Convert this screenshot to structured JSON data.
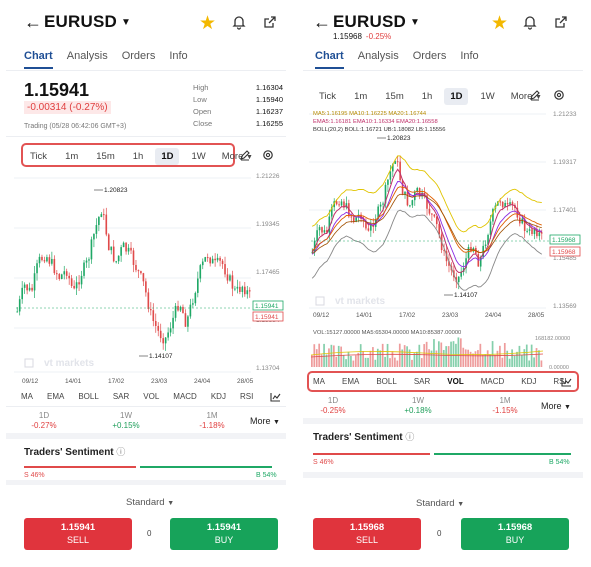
{
  "left": {
    "title": "EURUSD",
    "tabs": [
      "Chart",
      "Analysis",
      "Orders",
      "Info"
    ],
    "price": "1.15941",
    "change": "-0.00314 (-0.27%)",
    "trading_time": "Trading (05/28 06:42:06 GMT+3)",
    "stats": [
      {
        "label": "High",
        "value": "1.16304"
      },
      {
        "label": "Low",
        "value": "1.15940"
      },
      {
        "label": "Open",
        "value": "1.16237"
      },
      {
        "label": "Close",
        "value": "1.16255"
      }
    ],
    "timeframes": [
      "Tick",
      "1m",
      "15m",
      "1h",
      "1D",
      "1W",
      "More"
    ],
    "active_timeframe": "1D",
    "y_ticks": [
      "1.21226",
      "1.19345",
      "1.17465",
      "1.15584",
      "1.13704"
    ],
    "x_ticks": [
      "09/12",
      "14/01",
      "17/02",
      "23/03",
      "24/04",
      "28/05"
    ],
    "annotations": {
      "high": "1.20823",
      "low": "1.14107"
    },
    "price_tags": {
      "bid": "1.15941",
      "ask": "1.15941"
    },
    "watermark": "vt markets",
    "indicators": [
      "MA",
      "EMA",
      "BOLL",
      "SAR",
      "VOL",
      "MACD",
      "KDJ",
      "RSI"
    ],
    "changes": [
      {
        "label": "1D",
        "value": "-0.27%",
        "dir": "neg"
      },
      {
        "label": "1W",
        "value": "+0.15%",
        "dir": "pos"
      },
      {
        "label": "1M",
        "value": "-1.18%",
        "dir": "neg"
      }
    ],
    "more_label": "More",
    "sentiment_title": "Traders' Sentiment",
    "sentiment_sell": "S 46%",
    "sentiment_buy": "B 54%",
    "sell_fraction": 0.46,
    "order_type": "Standard",
    "sell_price": "1.15941",
    "sell_label": "SELL",
    "buy_price": "1.15941",
    "buy_label": "BUY",
    "spread": "0"
  },
  "right": {
    "title": "EURUSD",
    "subprice": "1.15968",
    "subchange": "-0.25%",
    "tabs": [
      "Chart",
      "Analysis",
      "Orders",
      "Info"
    ],
    "timeframes": [
      "Tick",
      "1m",
      "15m",
      "1h",
      "1D",
      "1W",
      "More"
    ],
    "active_timeframe": "1D",
    "legend_lines": [
      "MA5:1.16195  MA10:1.16225  MA20:1.16744",
      "EMA5:1.16181  EMA10:1.16334  EMA20:1.16558",
      "BOLL(20,2)  BOLL:1.16721  UB:1.18082  LB:1.15556"
    ],
    "y_ticks": [
      "1.21233",
      "1.19317",
      "1.17401",
      "1.15485",
      "1.13569"
    ],
    "x_ticks": [
      "09/12",
      "14/01",
      "17/02",
      "23/03",
      "24/04",
      "28/05"
    ],
    "annotations": {
      "high": "1.20823",
      "low": "1.14107"
    },
    "price_tags": {
      "bid": "1.15968",
      "ask": "1.15968"
    },
    "watermark": "vt markets",
    "vol_legend": "VOL:15127.00000  MA5:65304.00000  MA10:85387.00000",
    "vol_ticks": [
      "168182.00000",
      "0.00000"
    ],
    "indicators": [
      "MA",
      "EMA",
      "BOLL",
      "SAR",
      "VOL",
      "MACD",
      "KDJ",
      "RSI"
    ],
    "active_indicator": "VOL",
    "changes": [
      {
        "label": "1D",
        "value": "-0.25%",
        "dir": "neg"
      },
      {
        "label": "1W",
        "value": "+0.18%",
        "dir": "pos"
      },
      {
        "label": "1M",
        "value": "-1.15%",
        "dir": "neg"
      }
    ],
    "more_label": "More",
    "sentiment_title": "Traders' Sentiment",
    "sentiment_sell": "S 46%",
    "sentiment_buy": "B 54%",
    "sell_fraction": 0.46,
    "order_type": "Standard",
    "sell_price": "1.15968",
    "sell_label": "SELL",
    "buy_price": "1.15968",
    "buy_label": "BUY",
    "spread": "0"
  },
  "colors": {
    "bull": "#1fa866",
    "bear": "#e04a4a",
    "accent": "#1f4f95",
    "highlight": "#e25353",
    "star": "#f3b800"
  },
  "icons": [
    "back-arrow-icon",
    "dropdown-caret-icon",
    "star-icon",
    "bell-icon",
    "share-icon",
    "draw-pencil-icon",
    "settings-icon",
    "indicator-chart-icon",
    "info-icon",
    "chevron-down-icon"
  ]
}
